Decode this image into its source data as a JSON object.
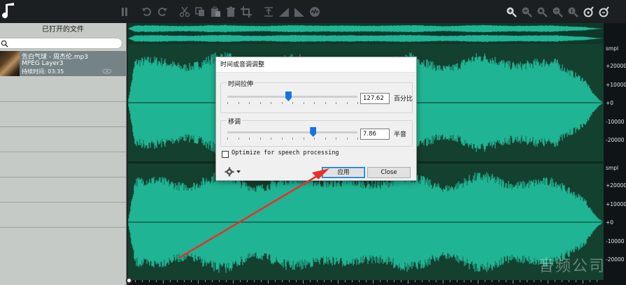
{
  "colors": {
    "waveform": "#1fb594",
    "wave_bg": "#14402f",
    "accent_blue": "#1473e6",
    "arrow_red": "#e8302a",
    "selected_row": "#758286"
  },
  "toolbar": {
    "left_icons": [
      "pause-icon",
      "undo-icon",
      "redo-icon",
      "cut-icon",
      "copy-icon",
      "paste-icon",
      "delete-icon",
      "crop-icon",
      "normalize-icon",
      "fade-in-icon",
      "fade-out-icon",
      "effect-icon"
    ],
    "right_icons": [
      "zoom-in-icon",
      "zoom-out-icon",
      "zoom-selection-icon",
      "zoom-full-icon",
      "zoom-vertical-icon",
      "zoom-reset-icon",
      "zoom-extra-icon"
    ]
  },
  "left_panel": {
    "title": "已打开的文件",
    "search_placeholder": "",
    "file": {
      "name": "告白气球 - 周杰伦.mp3",
      "format": "MPEG Layer3",
      "duration_label": "持续时间:",
      "duration": "03:35"
    }
  },
  "ruler": {
    "unit_top": "smpl",
    "top_labels": [
      "+20000",
      "+10000",
      "+0",
      "-10000",
      "-20000"
    ],
    "unit_bottom": "smpl",
    "bottom_labels": [
      "+20000",
      "+10000",
      "+0",
      "-10000",
      "-20000"
    ]
  },
  "dialog": {
    "title": "时间或音调调整",
    "stretch": {
      "label": "时间拉伸",
      "value": "127.62",
      "unit": "百分比",
      "slider_fraction": 0.47
    },
    "pitch": {
      "label": "移调",
      "value": "7.86",
      "unit": "半音",
      "slider_fraction": 0.66
    },
    "optimize_label": "Optimize for speech processing",
    "optimize_checked": false,
    "apply_label": "应用",
    "close_label": "Close"
  },
  "watermark": "音频公司"
}
